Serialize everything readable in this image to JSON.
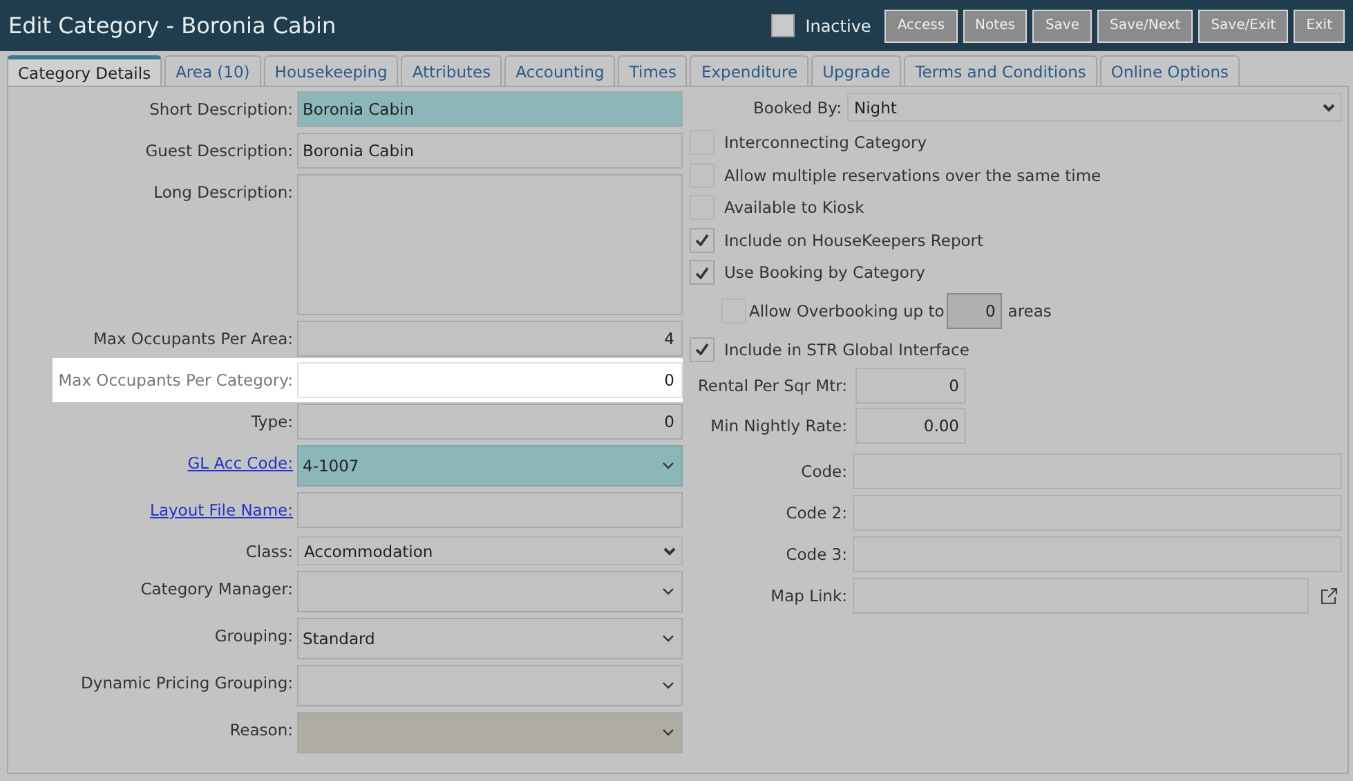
{
  "window": {
    "title": "Edit Category - Boronia Cabin"
  },
  "inactive": {
    "label": "Inactive",
    "checked": false
  },
  "buttons": [
    "Access",
    "Notes",
    "Save",
    "Save/Next",
    "Save/Exit",
    "Exit"
  ],
  "tabs": [
    {
      "label": "Category Details",
      "selected": true
    },
    {
      "label": "Area (10)",
      "selected": false
    },
    {
      "label": "Housekeeping",
      "selected": false
    },
    {
      "label": "Attributes",
      "selected": false
    },
    {
      "label": "Accounting",
      "selected": false
    },
    {
      "label": "Times",
      "selected": false
    },
    {
      "label": "Expenditure",
      "selected": false
    },
    {
      "label": "Upgrade",
      "selected": false
    },
    {
      "label": "Terms and Conditions",
      "selected": false
    },
    {
      "label": "Online Options",
      "selected": false
    }
  ],
  "left_fields": [
    {
      "label": "Short Description:",
      "kind": "text",
      "value": "Boronia Cabin",
      "required": true,
      "disabled": false,
      "link": false,
      "highlighted": false
    },
    {
      "label": "Guest Description:",
      "kind": "text",
      "value": "Boronia Cabin",
      "required": false,
      "disabled": false,
      "link": false,
      "highlighted": false
    },
    {
      "label": "Long Description:",
      "kind": "textarea",
      "required": false,
      "disabled": false,
      "link": false,
      "highlighted": false
    },
    {
      "label": "Max Occupants Per Area:",
      "kind": "number",
      "value": "4",
      "required": false,
      "disabled": false,
      "link": false,
      "highlighted": false
    },
    {
      "label": "Max Occupants Per Category:",
      "kind": "number",
      "value": "0",
      "required": false,
      "disabled": false,
      "link": false,
      "highlighted": true
    },
    {
      "label": "Type:",
      "kind": "number",
      "value": "0",
      "required": false,
      "disabled": false,
      "link": false,
      "highlighted": false
    },
    {
      "label": "GL Acc Code:",
      "kind": "select",
      "value": "4-1007",
      "required": true,
      "disabled": false,
      "link": true,
      "highlighted": false
    },
    {
      "label": "Layout File Name:",
      "kind": "text",
      "required": false,
      "disabled": false,
      "link": true,
      "highlighted": false
    },
    {
      "label": "Class:",
      "kind": "native-select",
      "value": "Accommodation",
      "required": false,
      "disabled": false,
      "link": false,
      "highlighted": false
    },
    {
      "label": "Category Manager:",
      "kind": "select",
      "required": false,
      "disabled": false,
      "link": false,
      "highlighted": false
    },
    {
      "label": "Grouping:",
      "kind": "select",
      "value": "Standard",
      "required": false,
      "disabled": false,
      "link": false,
      "highlighted": false
    },
    {
      "label": "Dynamic Pricing Grouping:",
      "kind": "select",
      "required": false,
      "disabled": false,
      "link": false,
      "highlighted": false
    },
    {
      "label": "Reason:",
      "kind": "select",
      "required": false,
      "disabled": true,
      "link": false,
      "highlighted": false
    }
  ],
  "right_fields": [
    {
      "kind": "native-select",
      "label": "Booked By:",
      "value": "Night"
    },
    {
      "kind": "checkbox",
      "label": "Interconnecting Category",
      "checked": false
    },
    {
      "kind": "checkbox",
      "label": "Allow multiple reservations over the same time",
      "checked": false
    },
    {
      "kind": "checkbox",
      "label": "Available to Kiosk",
      "checked": false
    },
    {
      "kind": "checkbox",
      "label": "Include on HouseKeepers Report",
      "checked": true
    },
    {
      "kind": "checkbox",
      "label": "Use Booking by Category",
      "checked": true
    },
    {
      "kind": "checkbox-input",
      "label": "Allow Overbooking up to",
      "checked": false,
      "value": "0",
      "suffix": "areas"
    },
    {
      "kind": "checkbox",
      "label": "Include in STR Global Interface",
      "checked": true
    },
    {
      "kind": "number",
      "label": "Rental Per Sqr Mtr:",
      "value": "0"
    },
    {
      "kind": "number",
      "label": "Min Nightly Rate:",
      "value": "0.00"
    },
    {
      "kind": "text",
      "label": "Code:"
    },
    {
      "kind": "text",
      "label": "Code 2:"
    },
    {
      "kind": "text",
      "label": "Code 3:"
    },
    {
      "kind": "link-text",
      "label": "Map Link:"
    }
  ]
}
